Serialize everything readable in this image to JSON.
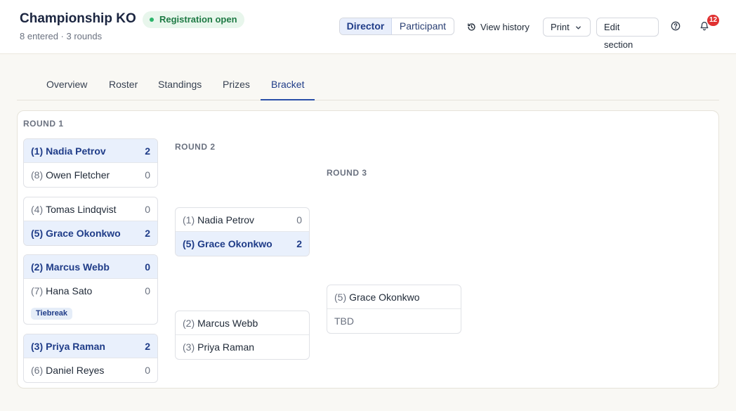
{
  "header": {
    "title": "Championship KO",
    "status_badge": "Registration open",
    "subtitle": "8 entered · 3 rounds",
    "view_toggle": {
      "active": "Director",
      "inactive": "Participant"
    },
    "view_history": "View history",
    "print": "Print",
    "edit_section": "Edit section",
    "notification_count": "12"
  },
  "tabs": [
    "Overview",
    "Roster",
    "Standings",
    "Prizes",
    "Bracket"
  ],
  "active_tab": "Bracket",
  "bracket": {
    "rounds": [
      {
        "label": "ROUND 1",
        "matches": [
          {
            "players": [
              {
                "seed": "(1)",
                "name": "Nadia Petrov",
                "score": "2",
                "winner": true
              },
              {
                "seed": "(8)",
                "name": "Owen Fletcher",
                "score": "0",
                "winner": false
              }
            ]
          },
          {
            "players": [
              {
                "seed": "(4)",
                "name": "Tomas Lindqvist",
                "score": "0",
                "winner": false
              },
              {
                "seed": "(5)",
                "name": "Grace Okonkwo",
                "score": "2",
                "winner": true
              }
            ]
          },
          {
            "players": [
              {
                "seed": "(2)",
                "name": "Marcus Webb",
                "score": "0",
                "winner": true
              },
              {
                "seed": "(7)",
                "name": "Hana Sato",
                "score": "0",
                "winner": false
              }
            ],
            "note": "Tiebreak"
          },
          {
            "players": [
              {
                "seed": "(3)",
                "name": "Priya Raman",
                "score": "2",
                "winner": true
              },
              {
                "seed": "(6)",
                "name": "Daniel Reyes",
                "score": "0",
                "winner": false
              }
            ]
          }
        ]
      },
      {
        "label": "ROUND 2",
        "matches": [
          {
            "players": [
              {
                "seed": "(1)",
                "name": "Nadia Petrov",
                "score": "0",
                "winner": false
              },
              {
                "seed": "(5)",
                "name": "Grace Okonkwo",
                "score": "2",
                "winner": true
              }
            ]
          },
          {
            "players": [
              {
                "seed": "(2)",
                "name": "Marcus Webb",
                "score": "",
                "winner": false
              },
              {
                "seed": "(3)",
                "name": "Priya Raman",
                "score": "",
                "winner": false
              }
            ]
          }
        ]
      },
      {
        "label": "ROUND 3",
        "matches": [
          {
            "players": [
              {
                "seed": "(5)",
                "name": "Grace Okonkwo",
                "score": "",
                "winner": false
              },
              {
                "seed": "",
                "name": "TBD",
                "score": "",
                "winner": false
              }
            ]
          }
        ]
      }
    ]
  }
}
